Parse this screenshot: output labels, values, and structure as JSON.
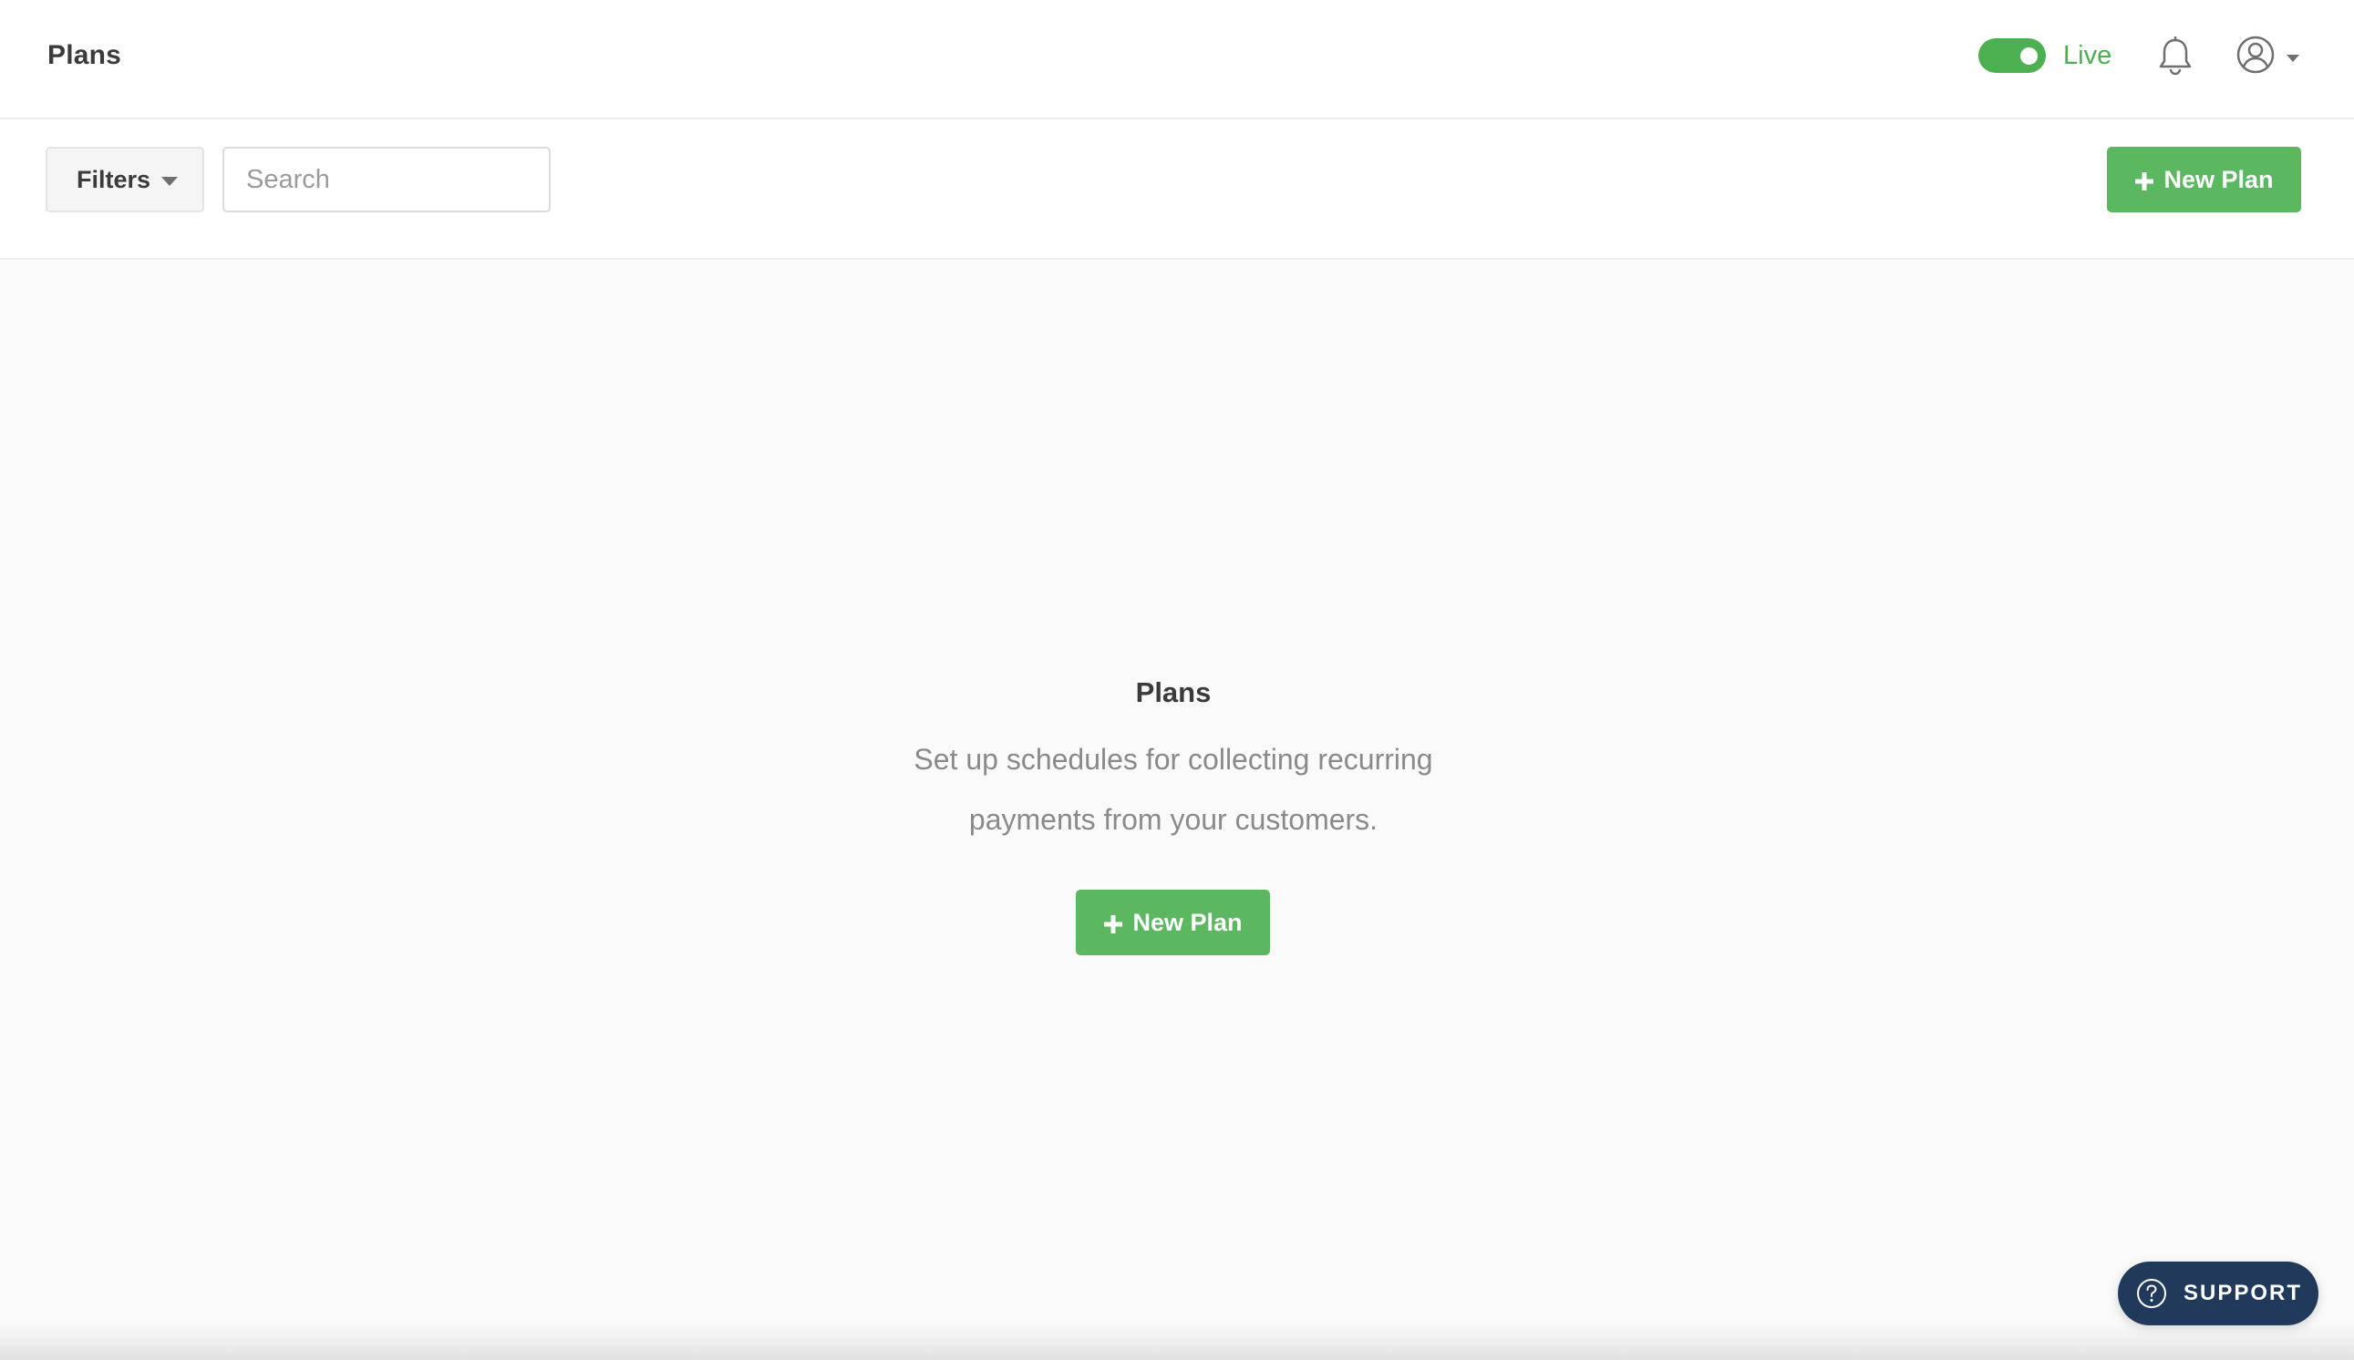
{
  "header": {
    "title": "Plans",
    "mode_toggle": {
      "label": "Live",
      "on": true,
      "color": "#4caf50"
    },
    "icons": {
      "notifications": "bell-icon",
      "account": "user-circle-icon",
      "account_menu": "chevron-down-icon"
    }
  },
  "toolbar": {
    "filters_label": "Filters",
    "search_placeholder": "Search",
    "search_value": "",
    "new_plan_label": "New Plan"
  },
  "empty_state": {
    "title": "Plans",
    "description": "Set up schedules for collecting recurring payments from your customers.",
    "button_label": "New Plan"
  },
  "support": {
    "label": "SUPPORT",
    "icon": "help-circle-icon"
  },
  "colors": {
    "primary_green": "#5cb860",
    "toggle_green": "#4caf50",
    "support_navy": "#21395a",
    "background": "#fafafa"
  }
}
